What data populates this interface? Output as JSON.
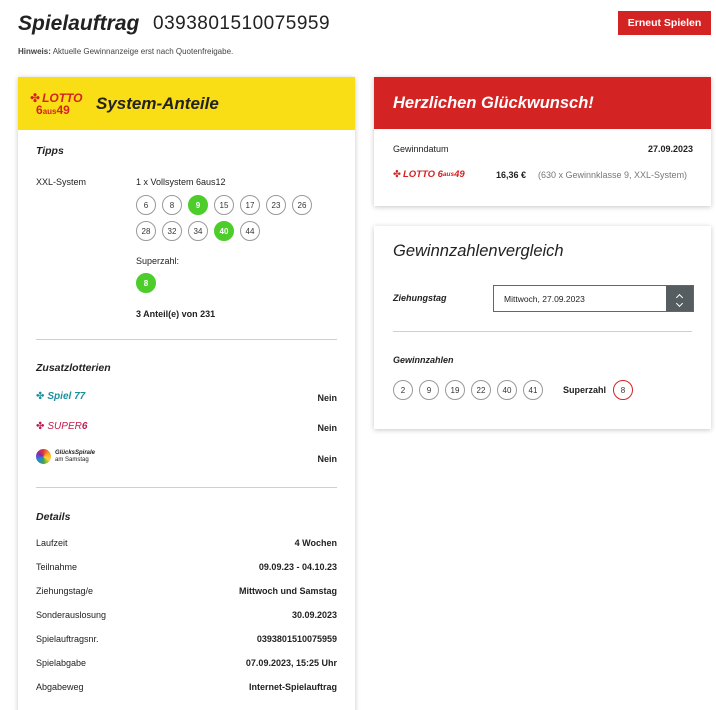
{
  "header": {
    "title": "Spielauftrag",
    "order_number": "0393801510075959",
    "replay_button": "Erneut Spielen",
    "hint_label": "Hinweis:",
    "hint_text": " Aktuelle Gewinnanzeige erst nach Quotenfreigabe."
  },
  "system_card": {
    "logo": {
      "word": "LOTTO",
      "six": "6",
      "aus": "aus",
      "fortynine": "49"
    },
    "title": "System-Anteile",
    "tipps_heading": "Tipps",
    "system_label": "XXL-System",
    "system_desc": "1 x Vollsystem 6aus12",
    "numbers": [
      {
        "n": "6",
        "hit": false
      },
      {
        "n": "8",
        "hit": false
      },
      {
        "n": "9",
        "hit": true
      },
      {
        "n": "15",
        "hit": false
      },
      {
        "n": "17",
        "hit": false
      },
      {
        "n": "23",
        "hit": false
      },
      {
        "n": "26",
        "hit": false
      },
      {
        "n": "28",
        "hit": false
      },
      {
        "n": "32",
        "hit": false
      },
      {
        "n": "34",
        "hit": false
      },
      {
        "n": "40",
        "hit": true
      },
      {
        "n": "44",
        "hit": false
      }
    ],
    "superzahl_label": "Superzahl:",
    "superzahl": "8",
    "shares": "3 Anteil(e) von 231",
    "zusatz_heading": "Zusatzlotterien",
    "zusatz": [
      {
        "name": "Spiel 77",
        "value": "Nein"
      },
      {
        "name": "SUPER",
        "suffix": "6",
        "value": "Nein"
      },
      {
        "name": "GlücksSpirale",
        "sub": "am Samstag",
        "value": "Nein"
      }
    ],
    "details_heading": "Details",
    "details": [
      {
        "label": "Laufzeit",
        "value": "4 Wochen"
      },
      {
        "label": "Teilnahme",
        "value": "09.09.23 - 04.10.23"
      },
      {
        "label": "Ziehungstag/e",
        "value": "Mittwoch und Samstag"
      },
      {
        "label": "Sonderauslosung",
        "value": "30.09.2023"
      },
      {
        "label": "Spielauftragsnr.",
        "value": "0393801510075959"
      },
      {
        "label": "Spielabgabe",
        "value": "07.09.2023, 15:25 Uhr"
      },
      {
        "label": "Abgabeweg",
        "value": "Internet-Spielauftrag"
      }
    ]
  },
  "congrats_card": {
    "title": "Herzlichen Glückwunsch!",
    "date_label": "Gewinndatum",
    "date_value": "27.09.2023",
    "amount": "16,36 €",
    "detail": "(630 x Gewinnklasse 9, XXL-System)"
  },
  "compare_card": {
    "title": "Gewinnzahlenvergleich",
    "draw_day_label": "Ziehungstag",
    "selected_draw": "Mittwoch, 27.09.2023",
    "numbers_heading": "Gewinnzahlen",
    "winning_numbers": [
      "2",
      "9",
      "19",
      "22",
      "40",
      "41"
    ],
    "superzahl_label": "Superzahl",
    "superzahl": "8"
  },
  "colors": {
    "accent_red": "#d42323",
    "lotto_yellow": "#f9dd15",
    "hit_green": "#4ccd2a"
  }
}
